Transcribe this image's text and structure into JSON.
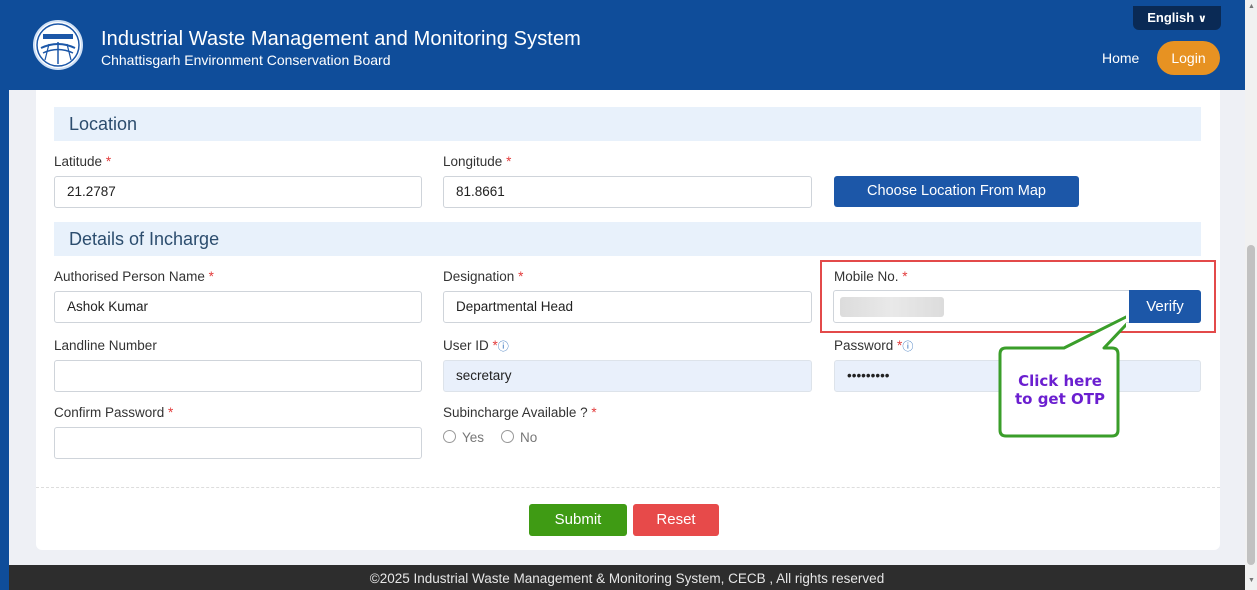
{
  "header": {
    "title": "Industrial Waste Management and Monitoring System",
    "subtitle": "Chhattisgarh Environment Conservation Board",
    "language": "English",
    "home": "Home",
    "login": "Login"
  },
  "location": {
    "heading": "Location",
    "latitude_label": "Latitude",
    "latitude_value": "21.2787",
    "longitude_label": "Longitude",
    "longitude_value": "81.8661",
    "map_button": "Choose Location From Map"
  },
  "incharge": {
    "heading": "Details of Incharge",
    "name_label": "Authorised Person Name",
    "name_value": "Ashok Kumar",
    "designation_label": "Designation",
    "designation_value": "Departmental Head",
    "mobile_label": "Mobile No.",
    "verify_button": "Verify",
    "landline_label": "Landline Number",
    "userid_label": "User ID",
    "userid_value": "secretary",
    "password_label": "Password",
    "password_value": "•••••••••",
    "confirm_label": "Confirm Password",
    "subincharge_label": "Subincharge Available ?",
    "yes": "Yes",
    "no": "No"
  },
  "callout": {
    "line1": "Click here",
    "line2": "to get OTP"
  },
  "actions": {
    "submit": "Submit",
    "reset": "Reset"
  },
  "footer": {
    "text": "©2025 Industrial Waste Management & Monitoring System, CECB , All rights reserved"
  },
  "required_mark": "*",
  "info_mark": "ⓘ",
  "chevron": "⌄"
}
